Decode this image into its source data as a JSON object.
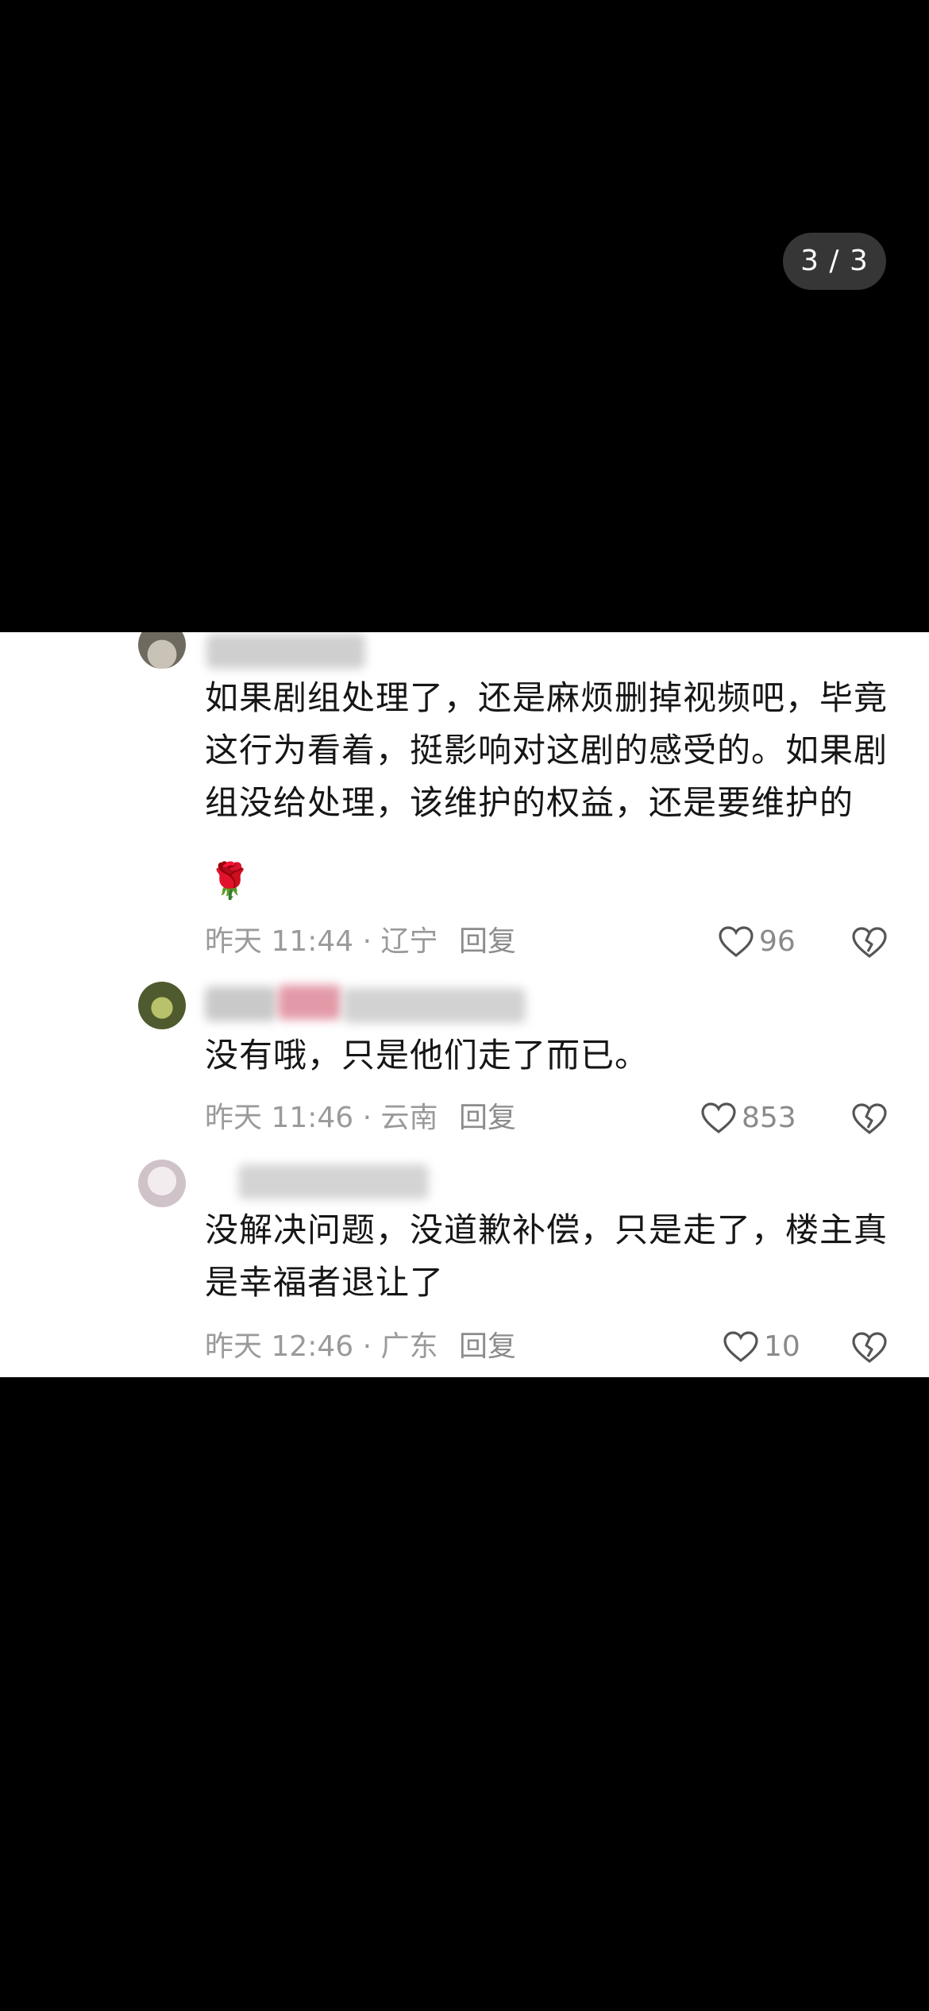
{
  "viewer": {
    "page_indicator": "3 / 3"
  },
  "comments": [
    {
      "text_lines": [
        "如果剧组处理了，还是麻烦删掉视频吧，毕竟",
        "这行为看着，挺影响对这剧的感受的。如果剧",
        "组没给处理，该维护的权益，还是要维护的"
      ],
      "emoji": "🌹",
      "time_location": "昨天 11:44 · 辽宁",
      "reply_label": "回复",
      "likes": "96"
    },
    {
      "text_lines": [
        "没有哦，只是他们走了而已。"
      ],
      "time_location": "昨天 11:46 · 云南",
      "reply_label": "回复",
      "likes": "853"
    },
    {
      "text_lines": [
        "没解决问题，没道歉补偿，只是走了，楼主真",
        "是幸福者退让了"
      ],
      "time_location": "昨天 12:46 · 广东",
      "reply_label": "回复",
      "likes": "10"
    }
  ],
  "icons": {
    "like": "heart-outline-icon",
    "dislike": "broken-heart-icon"
  },
  "colors": {
    "background": "#000000",
    "card": "#ffffff",
    "text": "#161616",
    "meta": "#9a9a9a"
  }
}
